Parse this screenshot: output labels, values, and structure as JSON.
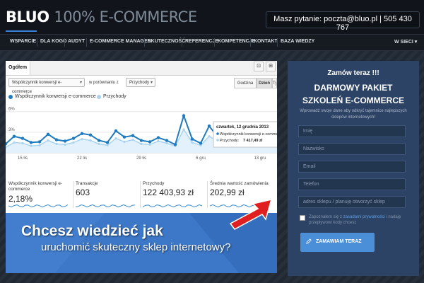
{
  "header": {
    "brand": "BLUO",
    "tagline": "100% E-COMMERCE",
    "contact": "Masz pytanie: poczta@bluo.pl | 505 430 767"
  },
  "nav": {
    "items": [
      "WSPARCIE",
      "DLA KOGO",
      "AUDYT",
      "E-COMMERCE MANAGER",
      "SKUTECZNOŚĆ",
      "REFERENCJE",
      "KOMPETENCJE",
      "KONTAKT",
      "BAZA WIEDZY"
    ],
    "right": "W SIECI"
  },
  "analytics": {
    "tab": "Ogółem",
    "metric_select": "Współczynnik konwersji e-commerce",
    "compare_label": "w porównaniu z",
    "compare_select": "Przychody",
    "granularity": [
      "Godzina",
      "Dzień",
      "Ty"
    ],
    "active_granularity": "Dzień",
    "legend": [
      {
        "name": "Współczynnik konwersji e-commerce",
        "color": "#1f7bbf"
      },
      {
        "name": "Przychody",
        "color": "#a9d3ef"
      }
    ],
    "tooltip": {
      "date": "czwartek, 12 grudnia 2013",
      "line1_label": "Współczynnik konwersji e-commerce:",
      "line1_value": "3,88%",
      "line2_label": "Przychody:",
      "line2_value": "7 417,49 zł"
    },
    "metrics": [
      {
        "label": "Współczynnik konwersji e-commerce",
        "value": "2,18%"
      },
      {
        "label": "Transakcje",
        "value": "603"
      },
      {
        "label": "Przychody",
        "value": "122 403,93 zł"
      },
      {
        "label": "Średnia wartość zamówienia",
        "value": "202,99 zł"
      }
    ]
  },
  "banner": {
    "line1": "Chcesz wiedzieć jak",
    "line2": "uruchomić skuteczny sklep internetowy?"
  },
  "form": {
    "title1": "Zamów teraz !!!",
    "title2": "DARMOWY PAKIET",
    "title3": "SZKOLEŃ E-COMMERCE",
    "description": "Wprowadź swoje dane aby odkryć tajemnice najlepszych sklepów internetowych!",
    "placeholders": [
      "Imię",
      "Nazwisko",
      "Email",
      "Telefon",
      "adres sklepu / planuję otworzyć sklep"
    ],
    "consent_prefix": "Zapoznałem się z",
    "consent_link": "zasadami prywatności",
    "consent_suffix": "i nadaję przepływowi kody chcesz",
    "submit": "ZAMAWIAM TERAZ"
  },
  "chart_data": {
    "type": "line",
    "title": "",
    "ylabel": "",
    "y_ticks": [
      "6%",
      "3%"
    ],
    "ylim": [
      0,
      7
    ],
    "x_tick_labels": [
      "15 lis",
      "22 lis",
      "29 lis",
      "6 gru",
      "13 gru"
    ],
    "x_tick_positions": [
      2,
      9,
      16,
      23,
      30
    ],
    "series": [
      {
        "name": "Współczynnik konwersji e-commerce",
        "color": "#1f7bbf",
        "values": [
          1.3,
          2.4,
          2.1,
          1.5,
          1.6,
          2.7,
          1.9,
          1.7,
          2.1,
          2.8,
          2.6,
          1.8,
          1.5,
          3.2,
          2.3,
          2.5,
          1.8,
          1.6,
          2.2,
          1.8,
          1.2,
          5.4,
          2.0,
          1.4,
          3.9,
          2.3,
          1.9,
          2.8,
          3.6,
          2.6,
          3.1,
          4.0,
          2.0
        ]
      },
      {
        "name": "Przychody",
        "color": "#a9d3ef",
        "values": [
          0.8,
          1.5,
          1.4,
          1.0,
          1.1,
          1.8,
          1.3,
          1.2,
          1.5,
          2.0,
          1.8,
          1.3,
          1.1,
          2.1,
          1.6,
          1.9,
          1.3,
          1.2,
          1.7,
          1.4,
          1.0,
          3.4,
          1.5,
          1.1,
          2.4,
          1.7,
          1.5,
          2.0,
          2.6,
          1.9,
          2.3,
          2.8,
          1.5
        ]
      }
    ],
    "highlight_index": 24,
    "grid": true
  }
}
